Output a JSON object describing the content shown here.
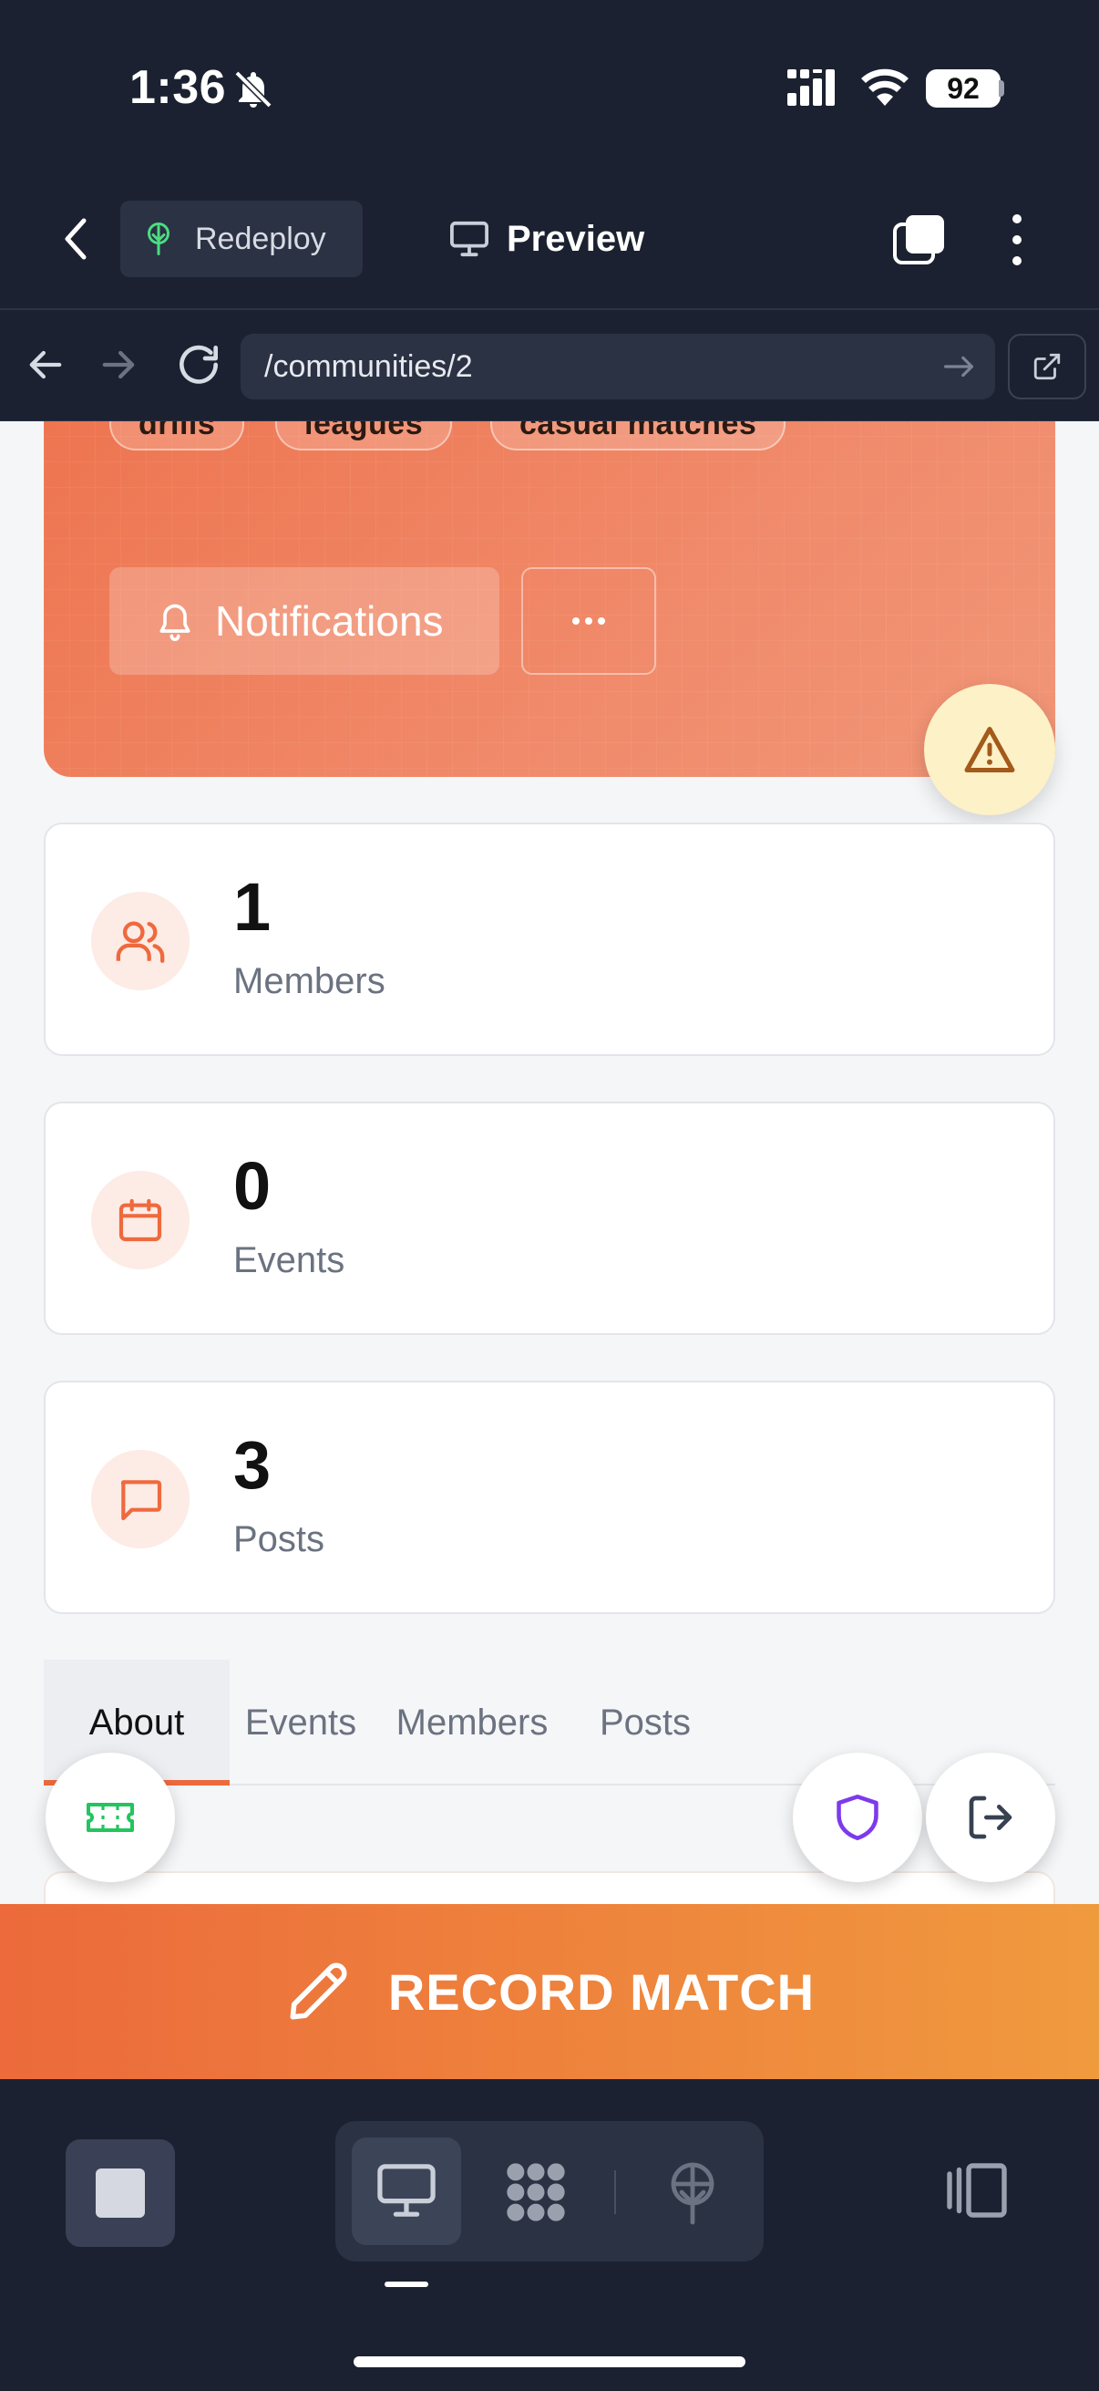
{
  "status_bar": {
    "time": "1:36",
    "battery": "92"
  },
  "header": {
    "redeploy_label": "Redeploy",
    "preview_label": "Preview"
  },
  "urlbar": {
    "url": "/communities/2"
  },
  "hero": {
    "tags": [
      "drills",
      "leagues",
      "casual matches"
    ],
    "notifications_label": "Notifications",
    "more_label": "···"
  },
  "stats": [
    {
      "value": "1",
      "label": "Members",
      "icon": "users-icon"
    },
    {
      "value": "0",
      "label": "Events",
      "icon": "calendar-icon"
    },
    {
      "value": "3",
      "label": "Posts",
      "icon": "message-icon"
    }
  ],
  "tabs": [
    "About",
    "Events",
    "Members",
    "Posts"
  ],
  "active_tab": "About",
  "record_match": {
    "label": "RECORD MATCH"
  },
  "colors": {
    "accent": "#ee6a3e",
    "bar_bg": "#1b2130",
    "warning_bg": "#fdf1c7",
    "shield": "#7c3aed",
    "ticket": "#22c55e"
  }
}
